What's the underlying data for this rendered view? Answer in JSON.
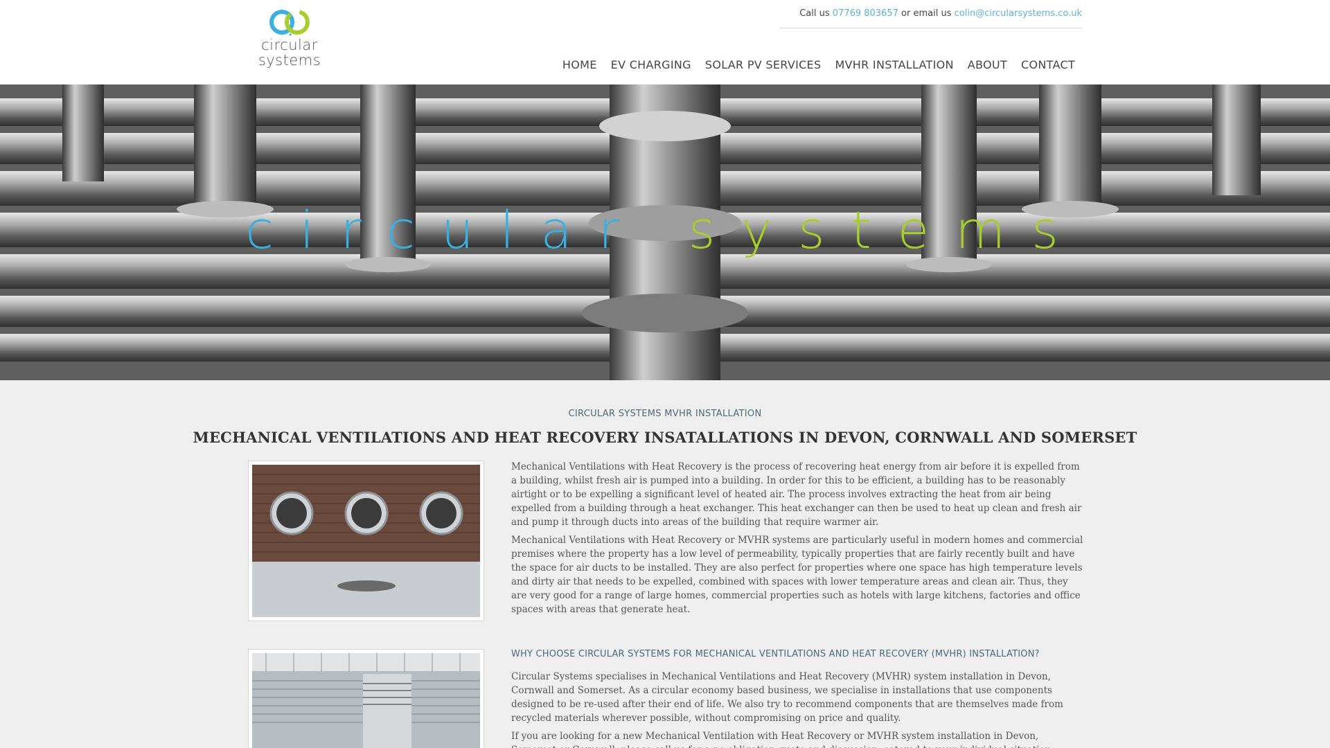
{
  "header": {
    "logo_line1": "circular",
    "logo_line2": "systems",
    "contact_prefix": "Call us",
    "phone": "07769 803657",
    "contact_mid": "or email us",
    "email": "colin@circularsystems.co.uk"
  },
  "nav": [
    "HOME",
    "EV CHARGING",
    "SOLAR PV SERVICES",
    "MVHR INSTALLATION",
    "ABOUT",
    "CONTACT"
  ],
  "hero": {
    "word1": "circular",
    "word2": "systems"
  },
  "content": {
    "subtitle": "CIRCULAR SYSTEMS MVHR INSTALLATION",
    "title": "MECHANICAL VENTILATIONS AND HEAT RECOVERY INSATALLATIONS IN DEVON, CORNWALL AND SOMERSET",
    "p1": "Mechanical Ventilations with Heat Recovery is the process of recovering heat energy from air before it is expelled from a building, whilst fresh air is pumped into a building. In order for this to be efficient, a building has to be reasonably airtight or to be expelling a significant level of heated air. The process involves extracting the heat from air being expelled from a building through a heat exchanger. This heat exchanger can then be used to heat up clean and fresh air and pump it through ducts into areas of the building that require warmer air.",
    "p2": "Mechanical Ventilations with Heat Recovery or MVHR systems are particularly useful in modern homes and commercial premises where the property has a low level of permeability, typically properties that are fairly recently built and have the space for air ducts to be installed. They are also perfect for properties where one space has high temperature levels and dirty air that needs to be expelled, combined with spaces with lower temperature areas and clean air. Thus, they are very good for a range of large homes, commercial properties such as hotels with large kitchens, factories and office spaces with areas that generate heat.",
    "why_heading": "WHY CHOOSE CIRCULAR SYSTEMS FOR MECHANICAL VENTILATIONS AND HEAT RECOVERY (MVHR) INSTALLATION?",
    "p3": "Circular Systems specialises in Mechanical Ventilations and Heat Recovery (MVHR) system installation in Devon, Cornwall and Somerset. As a circular economy based business, we specialise in installations that use components designed to be re-used after their end of life. We also try to recommend components that are themselves made from recycled materials wherever possible, without compromising on price and quality.",
    "p4": "If you are looking for a new Mechanical Ventilation with Heat Recovery or MVHR system installation in Devon, Somerset or Cornwall, please call us for a no obligation quote and discussion, catered to your individual situation."
  },
  "colors": {
    "blue": "#3aafe0",
    "green": "#a6cf2d",
    "link": "#5bb3d9"
  }
}
